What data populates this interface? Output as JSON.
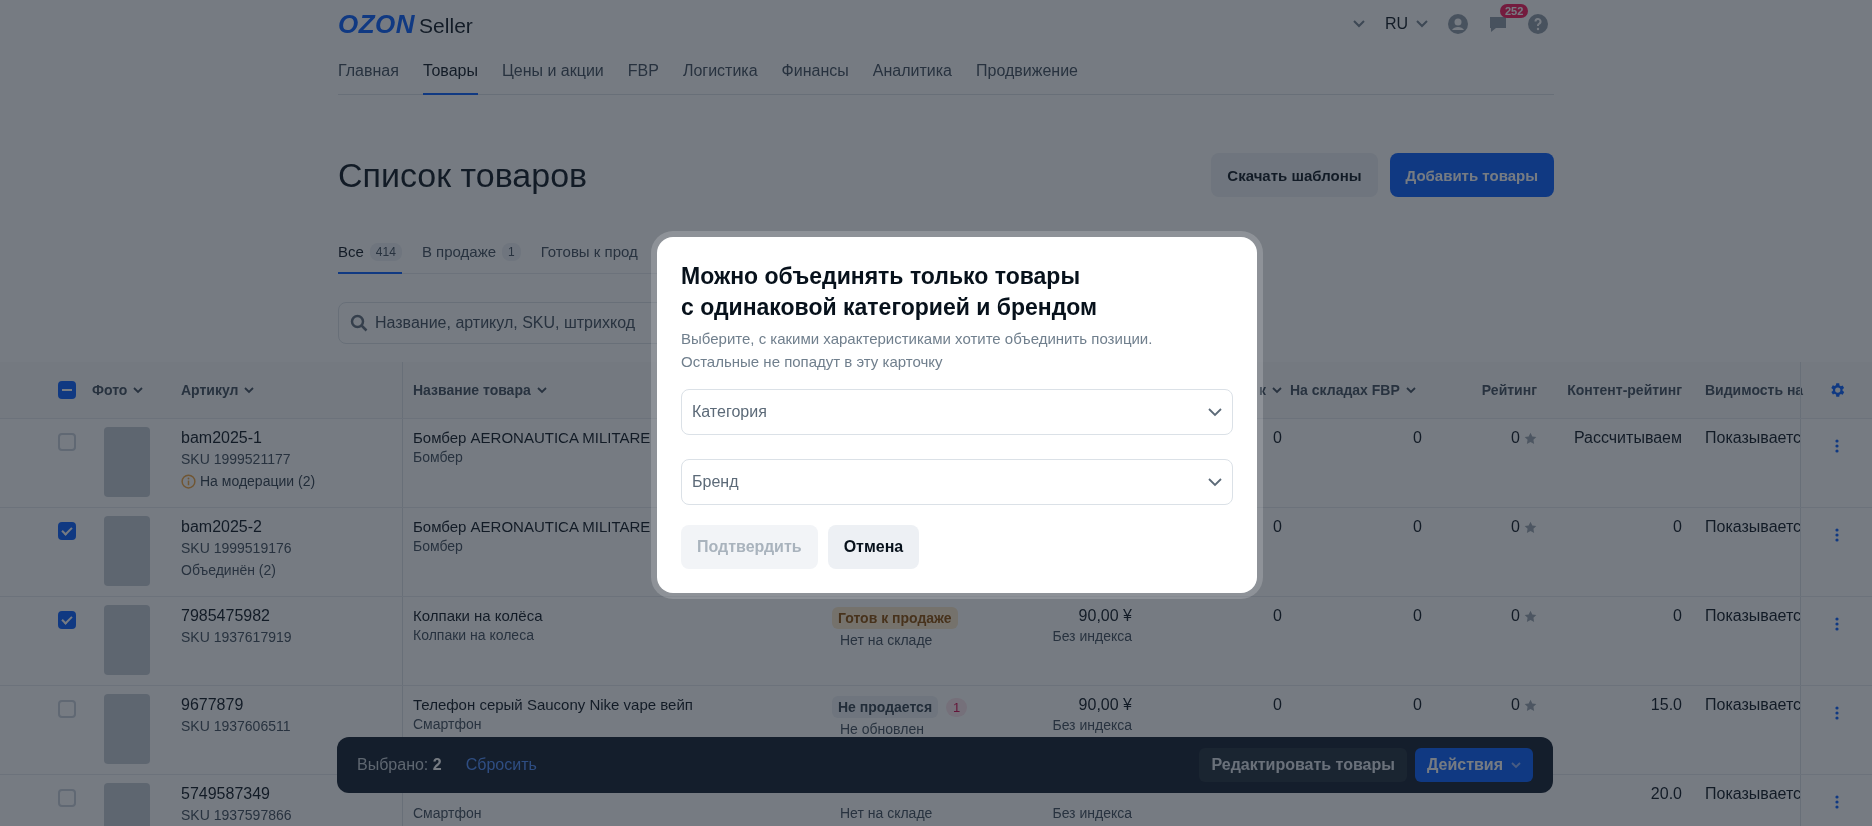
{
  "header": {
    "logo": "OZON",
    "logo_suffix": "Seller",
    "language": "RU",
    "notifications_count": "252"
  },
  "nav": [
    {
      "label": "Главная",
      "selected": false
    },
    {
      "label": "Товары",
      "selected": true
    },
    {
      "label": "Цены и акции",
      "selected": false
    },
    {
      "label": "FBP",
      "selected": false
    },
    {
      "label": "Логистика",
      "selected": false
    },
    {
      "label": "Финансы",
      "selected": false
    },
    {
      "label": "Аналитика",
      "selected": false
    },
    {
      "label": "Продвижение",
      "selected": false
    }
  ],
  "page_title": "Список товаров",
  "header_buttons": [
    {
      "label": "Скачать шаблоны",
      "kind": "secondary"
    },
    {
      "label": "Добавить товары",
      "kind": "primary"
    }
  ],
  "tabs": [
    {
      "label": "Все",
      "count": "414",
      "selected": true
    },
    {
      "label": "В продаже",
      "count": "1",
      "selected": false
    },
    {
      "label": "Готовы к прод",
      "selected": false
    }
  ],
  "search": {
    "placeholder": "Название, артикул, SKU, штрихкод"
  },
  "table": {
    "select_all": {
      "indeterminate": true
    },
    "columns": [
      {
        "label": "Фото",
        "sortable": true
      },
      {
        "label": "Артикул",
        "sortable": true
      },
      {
        "label": "Название товара",
        "sortable": true
      },
      {
        "label": "к",
        "sortable": true
      },
      {
        "label": "На складах FBP",
        "sortable": true
      },
      {
        "label": "Рейтинг",
        "sortable": false
      },
      {
        "label": "Контент-рейтинг",
        "sortable": false
      },
      {
        "label": "Видимость на",
        "sortable": false
      }
    ],
    "rows": [
      {
        "checked": false,
        "article": "bam2025-1",
        "sku": "SKU 1999521177",
        "note": {
          "text": "На модерации (2)",
          "kind": "warning"
        },
        "name": "Бомбер AERONAUTICA MILITARE",
        "category": "Бомбер",
        "col_5": "0",
        "fbp": "0",
        "rating": "0",
        "content_rating": "Рассчитываем",
        "visibility": "Показываетс"
      },
      {
        "checked": true,
        "article": "bam2025-2",
        "sku": "SKU 1999519176",
        "note": {
          "text": "Объединён (2)",
          "kind": "plain"
        },
        "name": "Бомбер AERONAUTICA MILITARE",
        "category": "Бомбер",
        "col_5": "0",
        "fbp": "0",
        "rating": "0",
        "content_rating": "0",
        "visibility": "Показываетс"
      },
      {
        "checked": true,
        "article": "7985475982",
        "sku": "SKU 1937617919",
        "name": "Колпаки на колёса",
        "category": "Колпаки на колеса",
        "status": {
          "label": "Готов к продаже",
          "kind": "ready"
        },
        "stock_note": "Нет на складе",
        "price": "90,00 ¥",
        "price_note": "Без индекса",
        "col_5": "0",
        "fbp": "0",
        "rating": "0",
        "content_rating": "0",
        "visibility": "Показываетс"
      },
      {
        "checked": false,
        "article": "9677879",
        "sku": "SKU 1937606511",
        "name": "Телефон серый Saucony Nike vape вейп",
        "category": "Смартфон",
        "status": {
          "label": "Не продается",
          "kind": "not_selling"
        },
        "status_count": "1",
        "stock_note": "Не обновлен",
        "price": "90,00 ¥",
        "price_note": "Без индекса",
        "col_5": "0",
        "fbp": "0",
        "rating": "0",
        "content_rating": "15.0",
        "visibility": "Показываетс"
      },
      {
        "checked": false,
        "article": "5749587349",
        "sku": "SKU 1937597866",
        "category": "Смартфон",
        "stock_note": "Нет на складе",
        "price_note": "Без индекса",
        "content_rating": "20.0",
        "visibility": "Показываетс"
      }
    ]
  },
  "selection_bar": {
    "label": "Выбрано:",
    "count": "2",
    "reset": "Сбросить",
    "buttons": [
      {
        "label": "Редактировать товары",
        "kind": "secondary",
        "dropdown": false
      },
      {
        "label": "Действия",
        "kind": "primary",
        "dropdown": true
      }
    ]
  },
  "modal": {
    "title_lines": [
      "Можно объединять только товары",
      "с одинаковой категорией и брендом"
    ],
    "description_lines": [
      "Выберите, с какими характеристиками хотите объединить позиции.",
      "Остальные не попадут в эту карточку"
    ],
    "fields": [
      {
        "placeholder": "Категория"
      },
      {
        "placeholder": "Бренд"
      }
    ],
    "buttons": [
      {
        "label": "Подтвердить",
        "kind": "primary",
        "disabled": true
      },
      {
        "label": "Отмена",
        "kind": "secondary",
        "disabled": false
      }
    ]
  }
}
